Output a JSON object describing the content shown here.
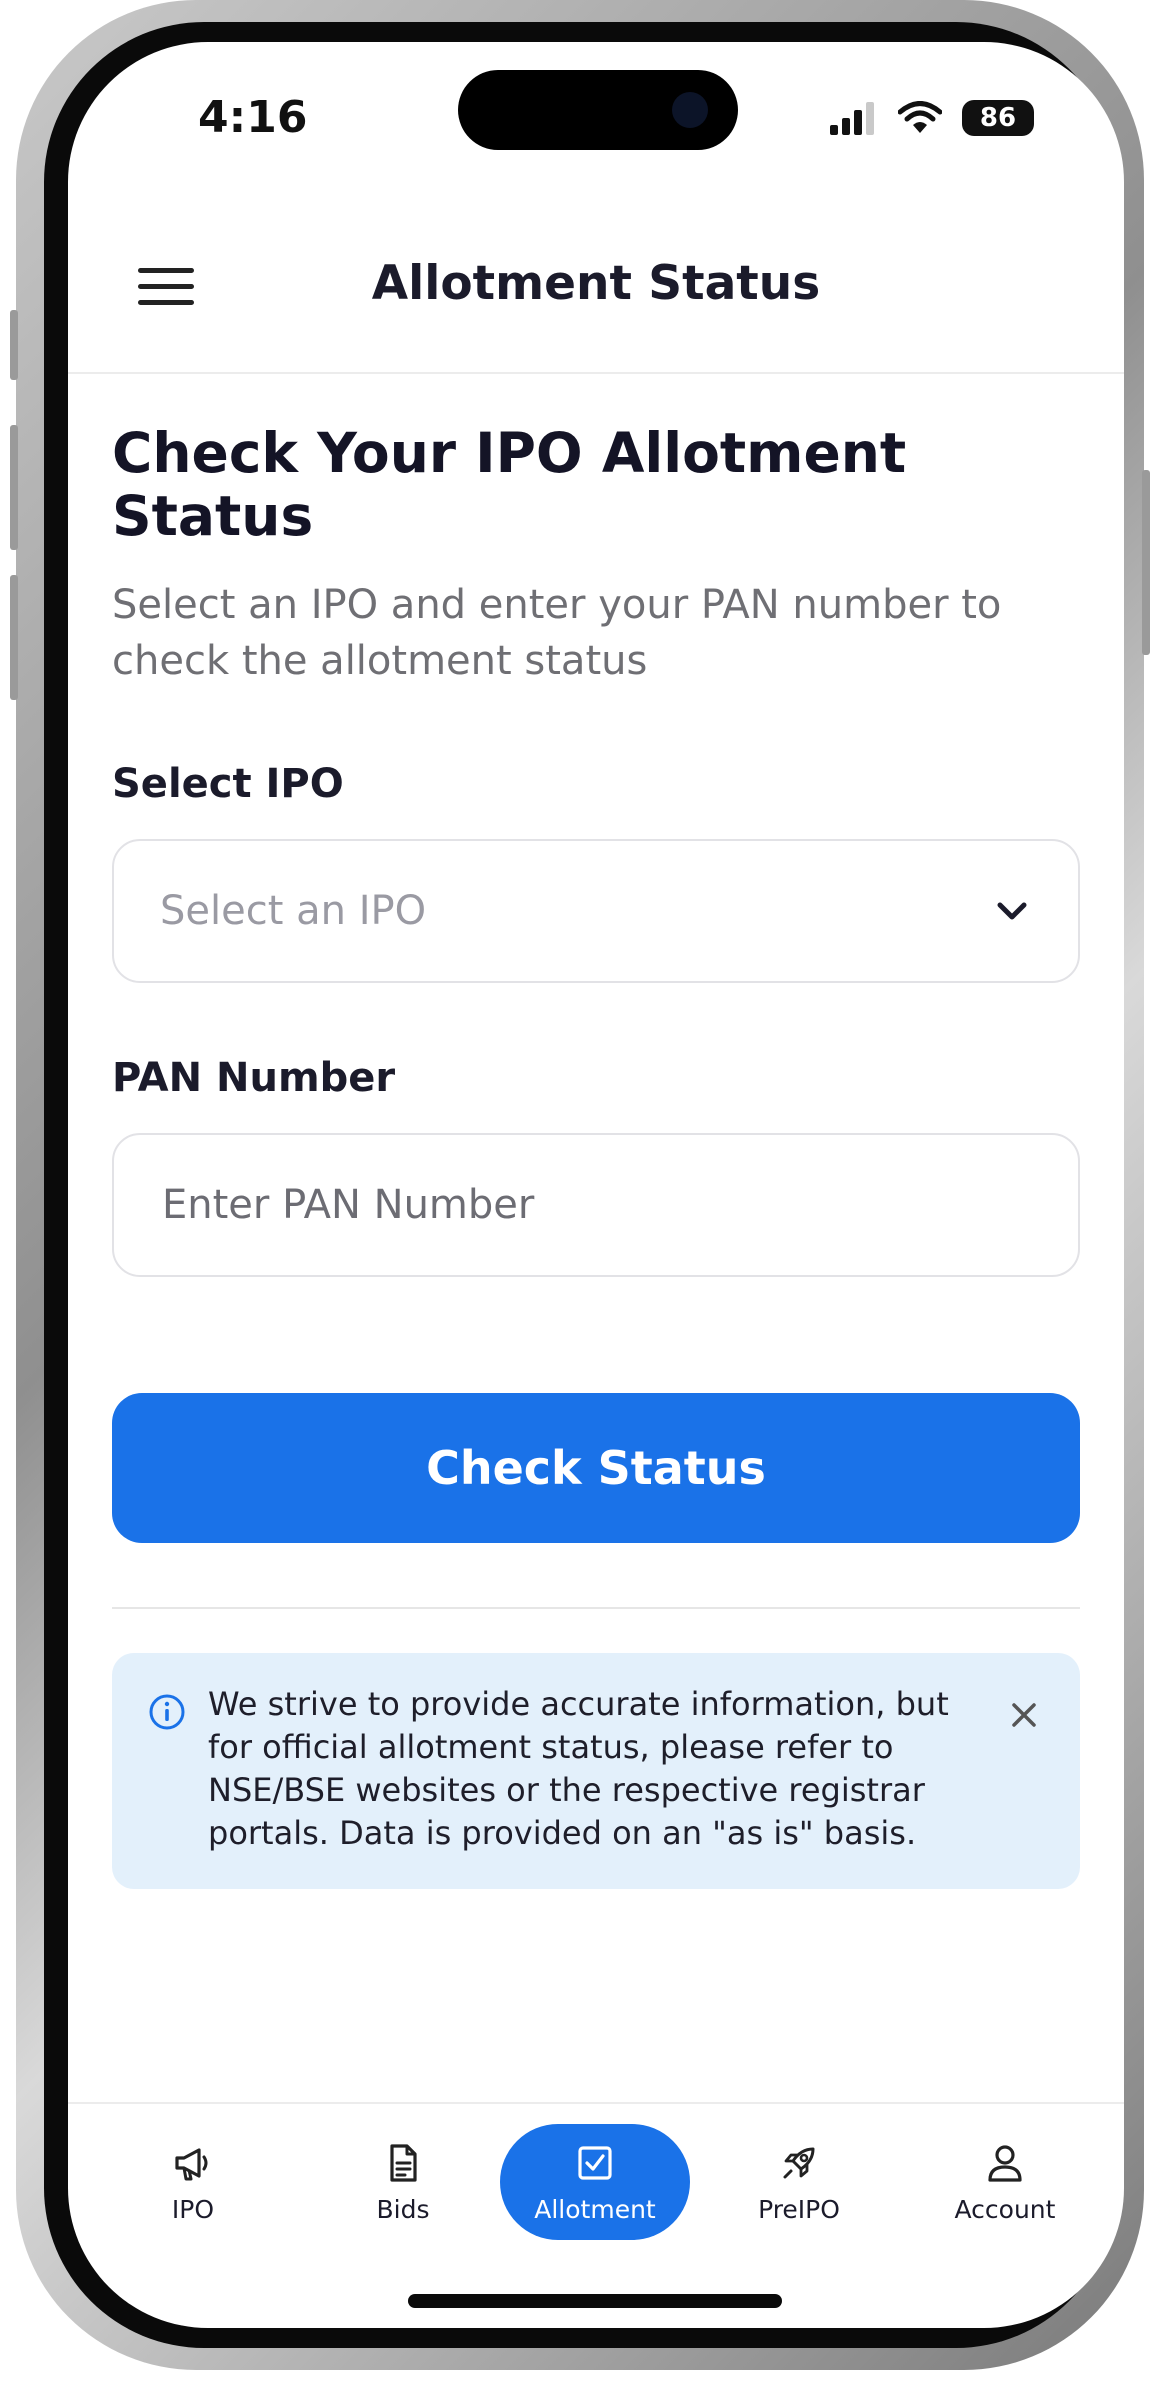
{
  "status_bar": {
    "time": "4:16",
    "battery": "86"
  },
  "header": {
    "title": "Allotment Status"
  },
  "main": {
    "heading": "Check Your IPO Allotment Status",
    "subheading": "Select an IPO and enter your PAN number to check the allotment status",
    "select_ipo": {
      "label": "Select IPO",
      "placeholder": "Select an IPO"
    },
    "pan": {
      "label": "PAN Number",
      "placeholder": "Enter PAN Number"
    },
    "check_button": "Check Status",
    "notice": "We strive to provide accurate information, but for official allotment status, please refer to NSE/BSE websites or the respective registrar portals. Data is provided on an \"as is\" basis."
  },
  "tabs": [
    {
      "label": "IPO",
      "icon": "megaphone-icon",
      "active": false
    },
    {
      "label": "Bids",
      "icon": "document-icon",
      "active": false
    },
    {
      "label": "Allotment",
      "icon": "checkbox-icon",
      "active": true
    },
    {
      "label": "PreIPO",
      "icon": "rocket-icon",
      "active": false
    },
    {
      "label": "Account",
      "icon": "user-icon",
      "active": false
    }
  ],
  "colors": {
    "accent": "#1a72e8",
    "notice_bg": "#e3f0fb"
  }
}
